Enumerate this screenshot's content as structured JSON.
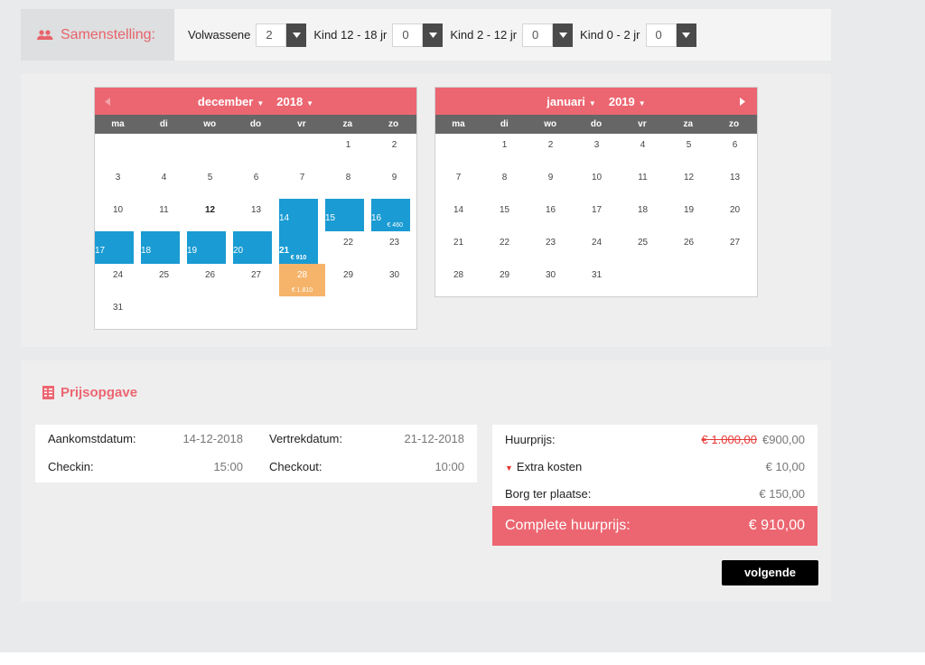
{
  "composition": {
    "title": "Samenstelling:",
    "fields": [
      {
        "label": "Volwassene",
        "value": "2"
      },
      {
        "label": "Kind 12 - 18 jr",
        "value": "0"
      },
      {
        "label": "Kind 2 - 12 jr",
        "value": "0"
      },
      {
        "label": "Kind 0 - 2 jr",
        "value": "0"
      }
    ]
  },
  "calendars": [
    {
      "month": "december",
      "year": "2018",
      "weekdays": [
        "ma",
        "di",
        "wo",
        "do",
        "vr",
        "za",
        "zo"
      ],
      "offset": 5,
      "days": [
        {
          "d": "1"
        },
        {
          "d": "2"
        },
        {
          "d": "3"
        },
        {
          "d": "4"
        },
        {
          "d": "5"
        },
        {
          "d": "6"
        },
        {
          "d": "7"
        },
        {
          "d": "8"
        },
        {
          "d": "9"
        },
        {
          "d": "10"
        },
        {
          "d": "11"
        },
        {
          "d": "12",
          "state": "bold"
        },
        {
          "d": "13"
        },
        {
          "d": "14",
          "state": "selected"
        },
        {
          "d": "15",
          "state": "selected"
        },
        {
          "d": "16",
          "state": "selected",
          "price": "€ 460",
          "price_align": "right"
        },
        {
          "d": "17",
          "state": "selected"
        },
        {
          "d": "18",
          "state": "selected"
        },
        {
          "d": "19",
          "state": "selected"
        },
        {
          "d": "20",
          "state": "selected"
        },
        {
          "d": "21",
          "state": "selected-bold",
          "price": "€ 910"
        },
        {
          "d": "22"
        },
        {
          "d": "23"
        },
        {
          "d": "24"
        },
        {
          "d": "25"
        },
        {
          "d": "26"
        },
        {
          "d": "27"
        },
        {
          "d": "28",
          "state": "departure",
          "price": "€ 1.810"
        },
        {
          "d": "29"
        },
        {
          "d": "30"
        },
        {
          "d": "31"
        }
      ]
    },
    {
      "month": "januari",
      "year": "2019",
      "weekdays": [
        "ma",
        "di",
        "wo",
        "do",
        "vr",
        "za",
        "zo"
      ],
      "offset": 1,
      "days": [
        {
          "d": "1"
        },
        {
          "d": "2"
        },
        {
          "d": "3"
        },
        {
          "d": "4"
        },
        {
          "d": "5"
        },
        {
          "d": "6"
        },
        {
          "d": "7"
        },
        {
          "d": "8"
        },
        {
          "d": "9"
        },
        {
          "d": "10"
        },
        {
          "d": "11"
        },
        {
          "d": "12"
        },
        {
          "d": "13"
        },
        {
          "d": "14"
        },
        {
          "d": "15"
        },
        {
          "d": "16"
        },
        {
          "d": "17"
        },
        {
          "d": "18"
        },
        {
          "d": "19"
        },
        {
          "d": "20"
        },
        {
          "d": "21"
        },
        {
          "d": "22"
        },
        {
          "d": "23"
        },
        {
          "d": "24"
        },
        {
          "d": "25"
        },
        {
          "d": "26"
        },
        {
          "d": "27"
        },
        {
          "d": "28"
        },
        {
          "d": "29"
        },
        {
          "d": "30"
        },
        {
          "d": "31"
        }
      ]
    }
  ],
  "quote": {
    "title": "Prijsopgave",
    "arrival_label": "Aankomstdatum:",
    "arrival_value": "14-12-2018",
    "departure_label": "Vertrekdatum:",
    "departure_value": "21-12-2018",
    "checkin_label": "Checkin:",
    "checkin_value": "15:00",
    "checkout_label": "Checkout:",
    "checkout_value": "10:00",
    "rent_label": "Huurprijs:",
    "rent_old": "€ 1.000,00",
    "rent_new": "€900,00",
    "extra_label": "Extra kosten",
    "extra_value": "€ 10,00",
    "deposit_label": "Borg ter plaatse:",
    "deposit_value": "€ 150,00",
    "total_label": "Complete huurprijs:",
    "total_value": "€ 910,00",
    "next_label": "volgende"
  },
  "colors": {
    "accent": "#ec6671",
    "selected": "#1a9bd3",
    "departure": "#f6b46b",
    "header_gray": "#666666"
  }
}
